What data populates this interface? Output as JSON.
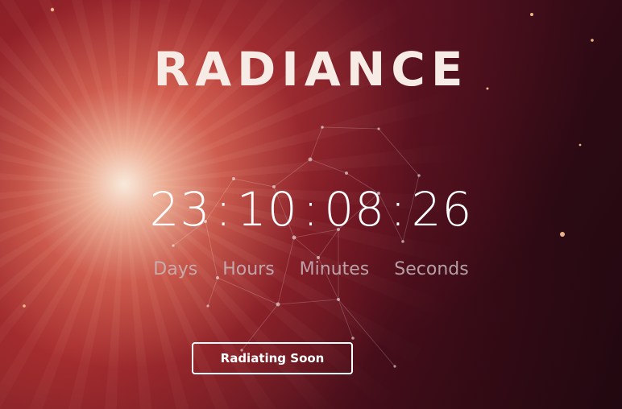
{
  "site": {
    "title": "RADIANCE"
  },
  "countdown": {
    "days": "23",
    "hours": "10",
    "minutes": "08",
    "seconds": "26",
    "separator": ":"
  },
  "labels": {
    "days": "Days",
    "hours": "Hours",
    "minutes": "Minutes",
    "seconds": "Seconds"
  },
  "cta": {
    "label": "Radiating Soon"
  },
  "colors": {
    "background_dark": "#3a0d16",
    "glow": "#ffe9dc",
    "title": "#f7ebe6",
    "label": "#c8b9be"
  }
}
